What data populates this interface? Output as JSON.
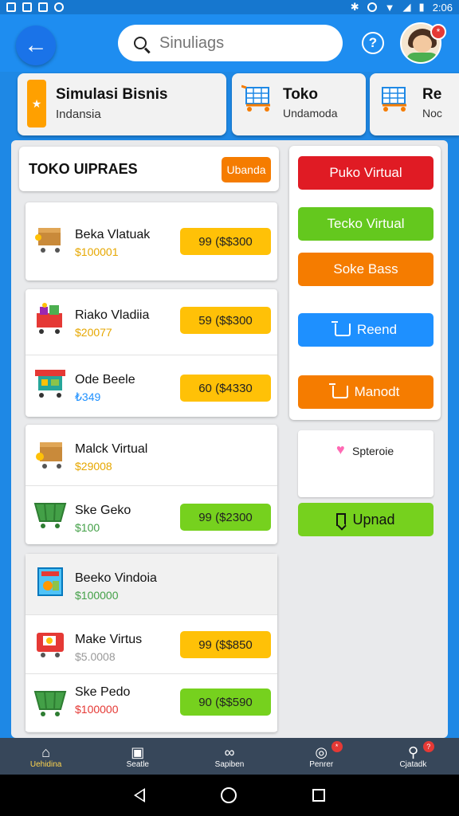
{
  "status_bar": {
    "time": "2:06"
  },
  "header": {
    "search_placeholder": "Sinuliags",
    "help_label": "?",
    "avatar_badge": "*"
  },
  "categories": [
    {
      "title": "Simulasi Bisnis",
      "subtitle": "Indansia",
      "icon": "star-tag-icon"
    },
    {
      "title": "Toko",
      "subtitle": "Undamoda",
      "icon": "cart-icon"
    },
    {
      "title": "Re",
      "subtitle": "Noc",
      "icon": "cart-icon"
    }
  ],
  "left_panel": {
    "title": "TOKO UIPRAES",
    "button": "Ubanda"
  },
  "groups": [
    {
      "items": [
        {
          "name": "Beka Vlatuak",
          "price": "$100001",
          "price_color": "#e6a700",
          "button": "99 ($$300",
          "button_color": "yellow",
          "icon": "box-cart-icon"
        }
      ]
    },
    {
      "items": [
        {
          "name": "Riako Vladiia",
          "price": "$20077",
          "price_color": "#e6a700",
          "button": "59 ($$300",
          "button_color": "yellow",
          "icon": "gift-cart-icon"
        },
        {
          "name": "Ode Beele",
          "price": "₺349",
          "price_color": "#1e90ff",
          "button": "60 ($4330",
          "button_color": "yellow",
          "icon": "stall-icon"
        }
      ]
    },
    {
      "items": [
        {
          "name": "Malck Virtual",
          "price": "$29008",
          "price_color": "#e6a700",
          "button": "",
          "button_color": "",
          "icon": "box-cart-icon"
        },
        {
          "name": "Ske Geko",
          "price": "$100",
          "price_color": "#43a047",
          "button": "99 ($2300",
          "button_color": "green",
          "icon": "green-basket-icon"
        }
      ]
    },
    {
      "items": [
        {
          "name": "Beeko Vindoia",
          "price": "$100000",
          "price_color": "#43a047",
          "button": "",
          "button_color": "",
          "icon": "kiosk-icon"
        },
        {
          "name": "Make Virtus",
          "price": "$5.0008",
          "price_color": "#999999",
          "button": "99 ($$850",
          "button_color": "yellow",
          "icon": "red-cart-icon"
        },
        {
          "name": "Ske Pedo",
          "price": "$100000",
          "price_color": "#e53935",
          "button": "90 ($$590",
          "button_color": "green",
          "icon": "green-basket-icon"
        }
      ]
    }
  ],
  "right_panel": {
    "buttons": [
      {
        "label": "Puko Virtual",
        "color": "#e01b24"
      },
      {
        "label": "Tecko Virtual",
        "color": "#64c81e"
      },
      {
        "label": "Soke Bass",
        "color": "#f57c00"
      },
      {
        "label": "Reend",
        "color": "#1e90ff"
      },
      {
        "label": "Manodt",
        "color": "#f57c00"
      }
    ],
    "note": "Spteroie",
    "upload": "Upnad"
  },
  "bottom_nav": [
    {
      "label": "Uehidina",
      "icon": "home-icon",
      "active": true
    },
    {
      "label": "Seatle",
      "icon": "document-icon",
      "active": false
    },
    {
      "label": "Sapiben",
      "icon": "link-icon",
      "active": false
    },
    {
      "label": "Penrer",
      "icon": "compass-icon",
      "active": false,
      "badge": "*"
    },
    {
      "label": "Cjatadk",
      "icon": "search-tool-icon",
      "active": false,
      "badge": "?"
    }
  ]
}
